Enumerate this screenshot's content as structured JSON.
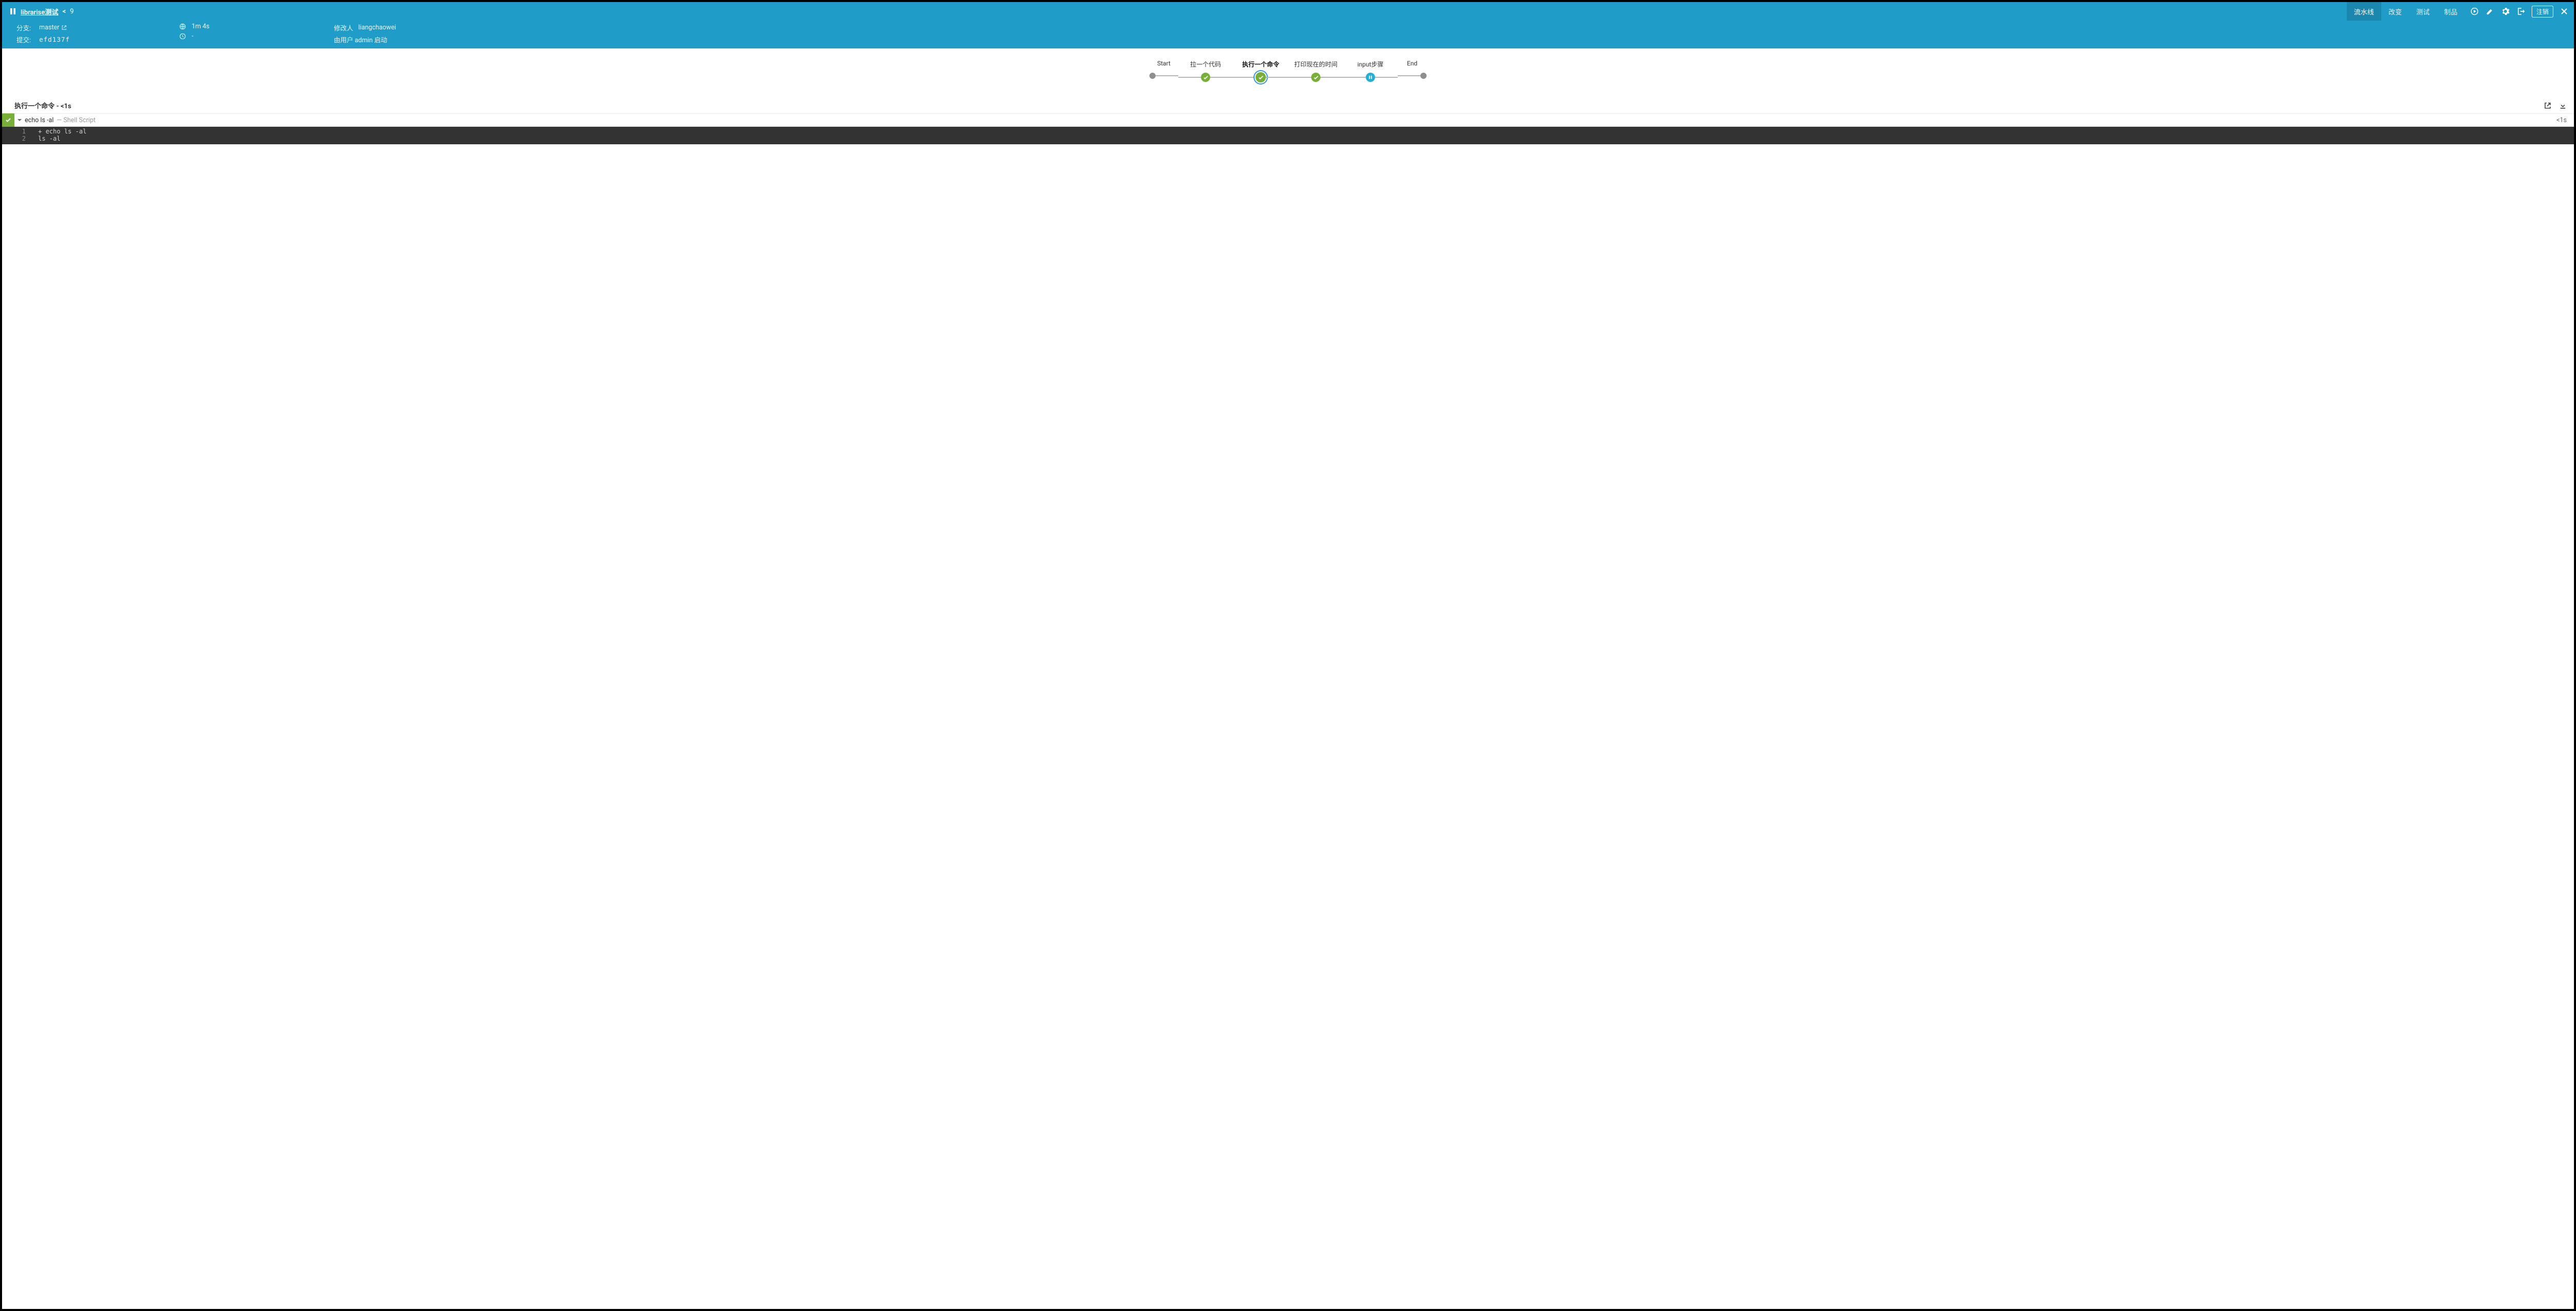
{
  "header": {
    "title": "librarise测试",
    "run_number": "9",
    "tabs": [
      {
        "label": "流水线",
        "active": true
      },
      {
        "label": "改变",
        "active": false
      },
      {
        "label": "测试",
        "active": false
      },
      {
        "label": "制品",
        "active": false
      }
    ],
    "logout_label": "注销"
  },
  "info": {
    "branch_label": "分支:",
    "branch_value": "master",
    "commit_label": "提交:",
    "commit_value": "efd137f",
    "duration": "1m 4s",
    "time_value": "-",
    "author_label": "修改人",
    "author_value": "liangchaowei",
    "started_by": "由用户 admin 启动"
  },
  "pipeline": {
    "stages": [
      {
        "label": "Start",
        "type": "dot"
      },
      {
        "label": "拉一个代码",
        "type": "success"
      },
      {
        "label": "执行一个命令",
        "type": "success-active"
      },
      {
        "label": "打印现在的时间",
        "type": "success"
      },
      {
        "label": "input步骤",
        "type": "pause"
      },
      {
        "label": "End",
        "type": "dot"
      }
    ]
  },
  "step": {
    "title": "执行一个命令 - <1s",
    "command": "echo ls -al",
    "command_type": "— Shell Script",
    "duration": "<1s",
    "console": [
      {
        "n": "1",
        "t": "+ echo ls -al"
      },
      {
        "n": "2",
        "t": "ls -al"
      }
    ]
  }
}
